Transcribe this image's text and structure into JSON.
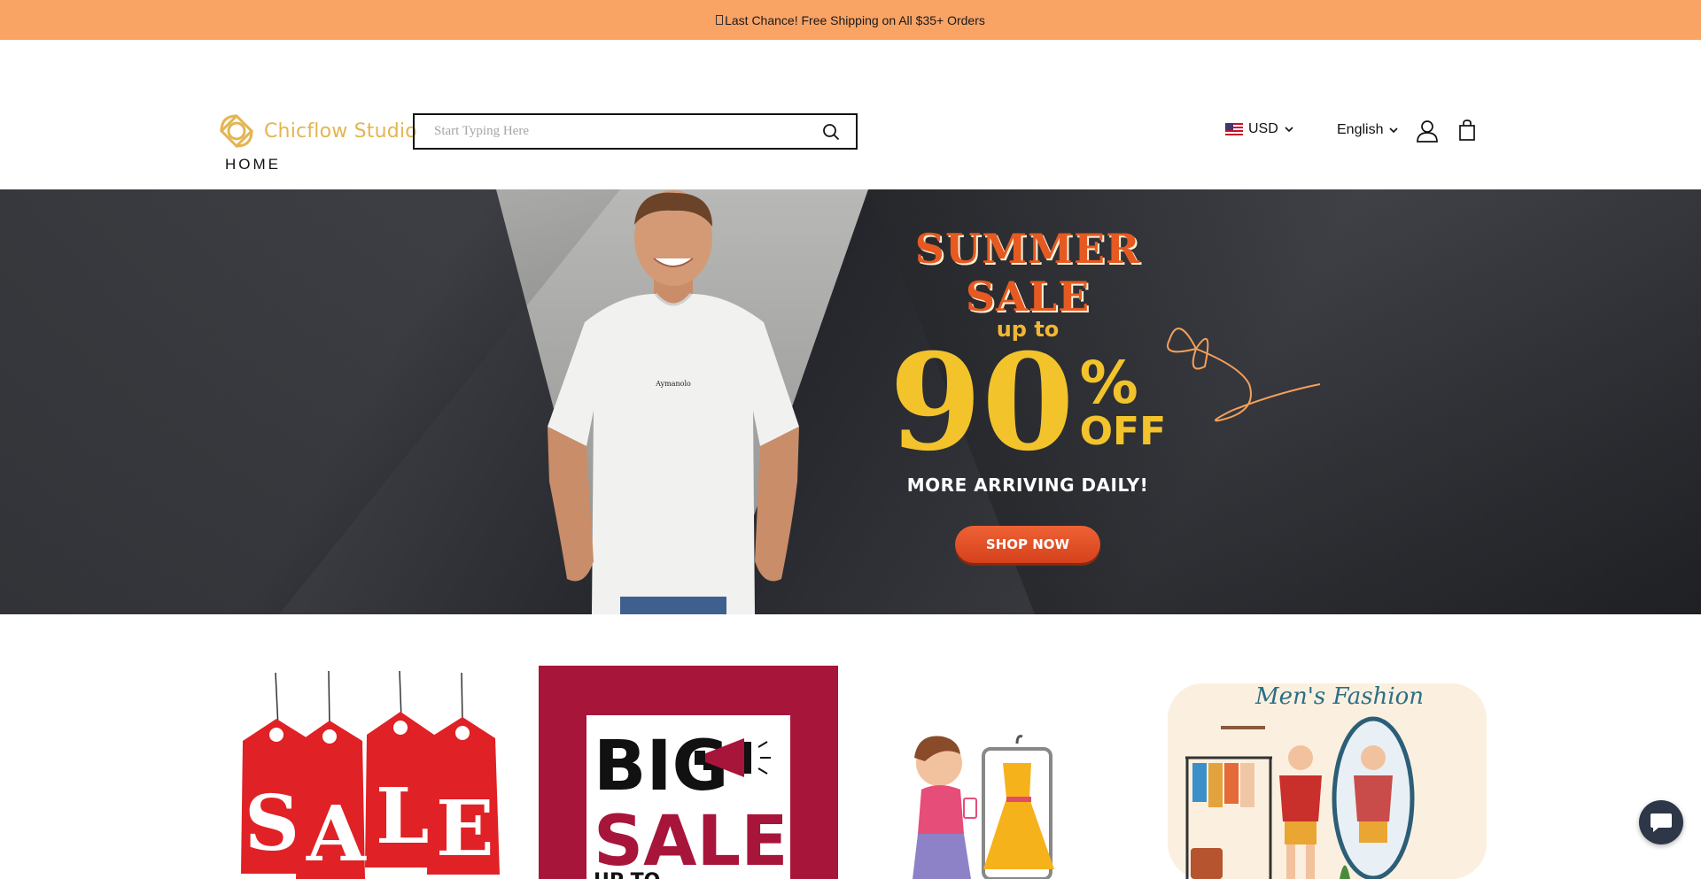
{
  "announcement": {
    "text": "Last Chance! Free Shipping on All $35+ Orders"
  },
  "brand": {
    "name": "Chicflow Studio",
    "color": "#e3b552"
  },
  "search": {
    "placeholder": "Start Typing Here"
  },
  "header": {
    "currency": "USD",
    "language": "English"
  },
  "nav": {
    "items": [
      "HOME"
    ]
  },
  "hero": {
    "title": "SUMMER SALE",
    "upto": "up to",
    "percent": "90",
    "percent_sign": "%",
    "off": "OFF",
    "subtitle": "MORE ARRIVING DAILY!",
    "cta": "SHOP NOW",
    "tshirt_print": "Aymanolo"
  },
  "tiles": [
    {
      "text": "SALE"
    },
    {
      "line1": "BIG",
      "line2": "SALE",
      "line3": "UP TO"
    },
    {
      "text": ""
    },
    {
      "text": "Men's Fashion"
    }
  ],
  "colors": {
    "announcement_bg": "#f9a365",
    "accent_orange": "#e65a21",
    "accent_yellow": "#f3c32c",
    "chat_bg": "#2d3747"
  }
}
